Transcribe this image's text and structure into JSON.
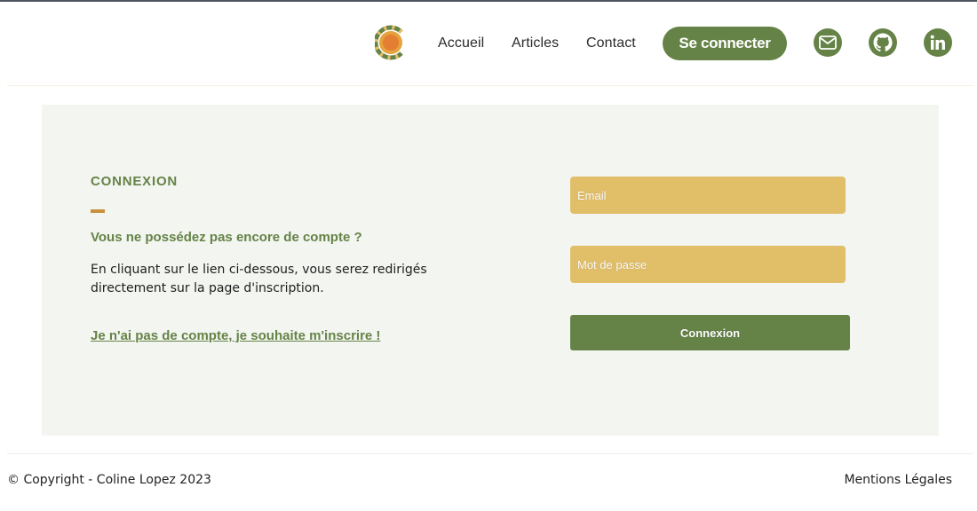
{
  "nav": {
    "links": [
      {
        "label": "Accueil"
      },
      {
        "label": "Articles"
      },
      {
        "label": "Contact"
      }
    ],
    "login_button": "Se connecter",
    "social_icons": [
      "mail-icon",
      "github-icon",
      "linkedin-icon"
    ]
  },
  "panel": {
    "title": "CONNEXION",
    "subtitle": "Vous ne possédez pas encore de compte ?",
    "description": "En cliquant sur le lien ci-dessous, vous serez redirigés directement sur la page d'inscription.",
    "signup_link": "Je n'ai pas de compte, je souhaite m'inscrire !"
  },
  "form": {
    "email_placeholder": "Email",
    "password_placeholder": "Mot de passe",
    "submit_label": "Connexion"
  },
  "footer": {
    "copyright": "© Copyright - Coline Lopez 2023",
    "legal": "Mentions Légales"
  },
  "colors": {
    "accent_green": "#658346",
    "field_yellow": "#e1be68",
    "accent_orange": "#c9913d",
    "panel_bg": "#f3f5f1"
  }
}
